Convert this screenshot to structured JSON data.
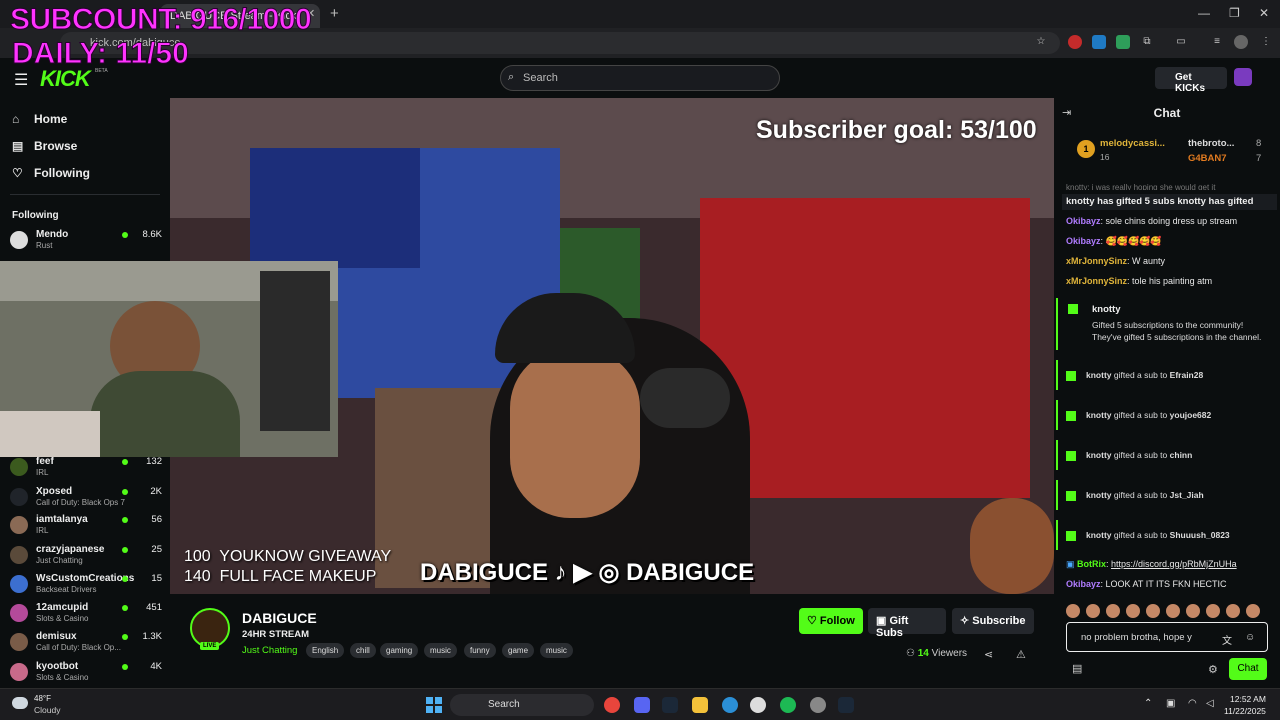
{
  "overlay": {
    "subcount": "SUBCOUNT: 916/1000",
    "daily": "DAILY: 11/50"
  },
  "browser": {
    "tab_title": "DABIGUCE Stream - Kick",
    "url": "kick.com/dabiguce"
  },
  "header": {
    "logo": "KICK",
    "beta": "BETA",
    "search_placeholder": "Search",
    "get_kicks_label": "Get KICKs"
  },
  "sidebar": {
    "nav": [
      {
        "label": "Home",
        "icon": "home-icon"
      },
      {
        "label": "Browse",
        "icon": "browse-icon"
      },
      {
        "label": "Following",
        "icon": "heart-icon"
      }
    ],
    "following_title": "Following",
    "channels": [
      {
        "name": "Mendo",
        "category": "Rust",
        "viewers": "8.6K"
      },
      {
        "name": "feef",
        "category": "IRL",
        "viewers": "132"
      },
      {
        "name": "Xposed",
        "category": "Call of Duty: Black Ops 7",
        "viewers": "2K"
      },
      {
        "name": "iamtalanya",
        "category": "IRL",
        "viewers": "56"
      },
      {
        "name": "crazyjapanese",
        "category": "Just Chatting",
        "viewers": "25"
      },
      {
        "name": "WsCustomCreations",
        "category": "Backseat Drivers",
        "viewers": "15"
      },
      {
        "name": "12amcupid",
        "category": "Slots & Casino",
        "viewers": "451"
      },
      {
        "name": "demisux",
        "category": "Call of Duty: Black Op...",
        "viewers": "1.3K"
      },
      {
        "name": "kyootbot",
        "category": "Slots & Casino",
        "viewers": "4K"
      }
    ]
  },
  "video": {
    "subscriber_goal": "Subscriber goal: 53/100",
    "giveaway": "100  YOUKNOW GIVEAWAY\n140  FULL FACE MAKEUP",
    "socials": "DABIGUCE ♪ ▶ ◎ DABIGUCE"
  },
  "stream": {
    "streamer": "DABIGUCE",
    "live": "LIVE",
    "title": "24HR STREAM",
    "category": "Just Chatting",
    "tags": [
      "English",
      "chill",
      "gaming",
      "music",
      "funny",
      "game",
      "music"
    ],
    "follow_label": "Follow",
    "gift_subs_label": "Gift Subs",
    "subscribe_label": "Subscribe",
    "viewers_count": "14",
    "viewers_label": "Viewers"
  },
  "chat": {
    "title": "Chat",
    "leaderboard": [
      {
        "rank": "1",
        "name": "melodycassi...",
        "count": "16"
      },
      {
        "name": "thebroto...",
        "count": "8"
      },
      {
        "name": "G4BAN7",
        "count": "7"
      }
    ],
    "pinned": "knotty has gifted 5 subs   knotty has gifted",
    "partial_line": "knotty: i was really hoping she would get it",
    "messages": [
      {
        "user": "Okibayz",
        "text": "sole chins doing dress up stream",
        "color": "#b07cff"
      },
      {
        "user": "Okibayz",
        "text": "🥰🥰🥰🥰🥰",
        "color": "#b07cff"
      },
      {
        "user": "xMrJonnySinz",
        "text": "W aunty",
        "color": "#e0b43a"
      },
      {
        "user": "xMrJonnySinz",
        "text": "tole his painting atm",
        "color": "#e0b43a"
      }
    ],
    "gift_big": {
      "user": "knotty",
      "line1": "Gifted 5 subscriptions to the community!",
      "line2": "They've gifted 5 subscriptions in the channel."
    },
    "gifts": [
      {
        "user": "knotty",
        "mid": "gifted a sub to",
        "to": "Efrain28"
      },
      {
        "user": "knotty",
        "mid": "gifted a sub to",
        "to": "youjoe682"
      },
      {
        "user": "knotty",
        "mid": "gifted a sub to",
        "to": "chinn"
      },
      {
        "user": "knotty",
        "mid": "gifted a sub to",
        "to": "Jst_Jiah"
      },
      {
        "user": "knotty",
        "mid": "gifted a sub to",
        "to": "Shuuush_0823"
      }
    ],
    "botrix": {
      "user": "BotRix",
      "text": "https://discord.gg/pRbMjZnUHa"
    },
    "last": {
      "user": "Okibayz",
      "text": "LOOK AT IT ITS FKN HECTIC"
    },
    "input_value": "no problem brotha, hope y",
    "send_label": "Chat"
  },
  "taskbar": {
    "temp": "48°F",
    "weather": "Cloudy",
    "search": "Search",
    "time": "12:52 AM",
    "date": "11/22/2025"
  }
}
